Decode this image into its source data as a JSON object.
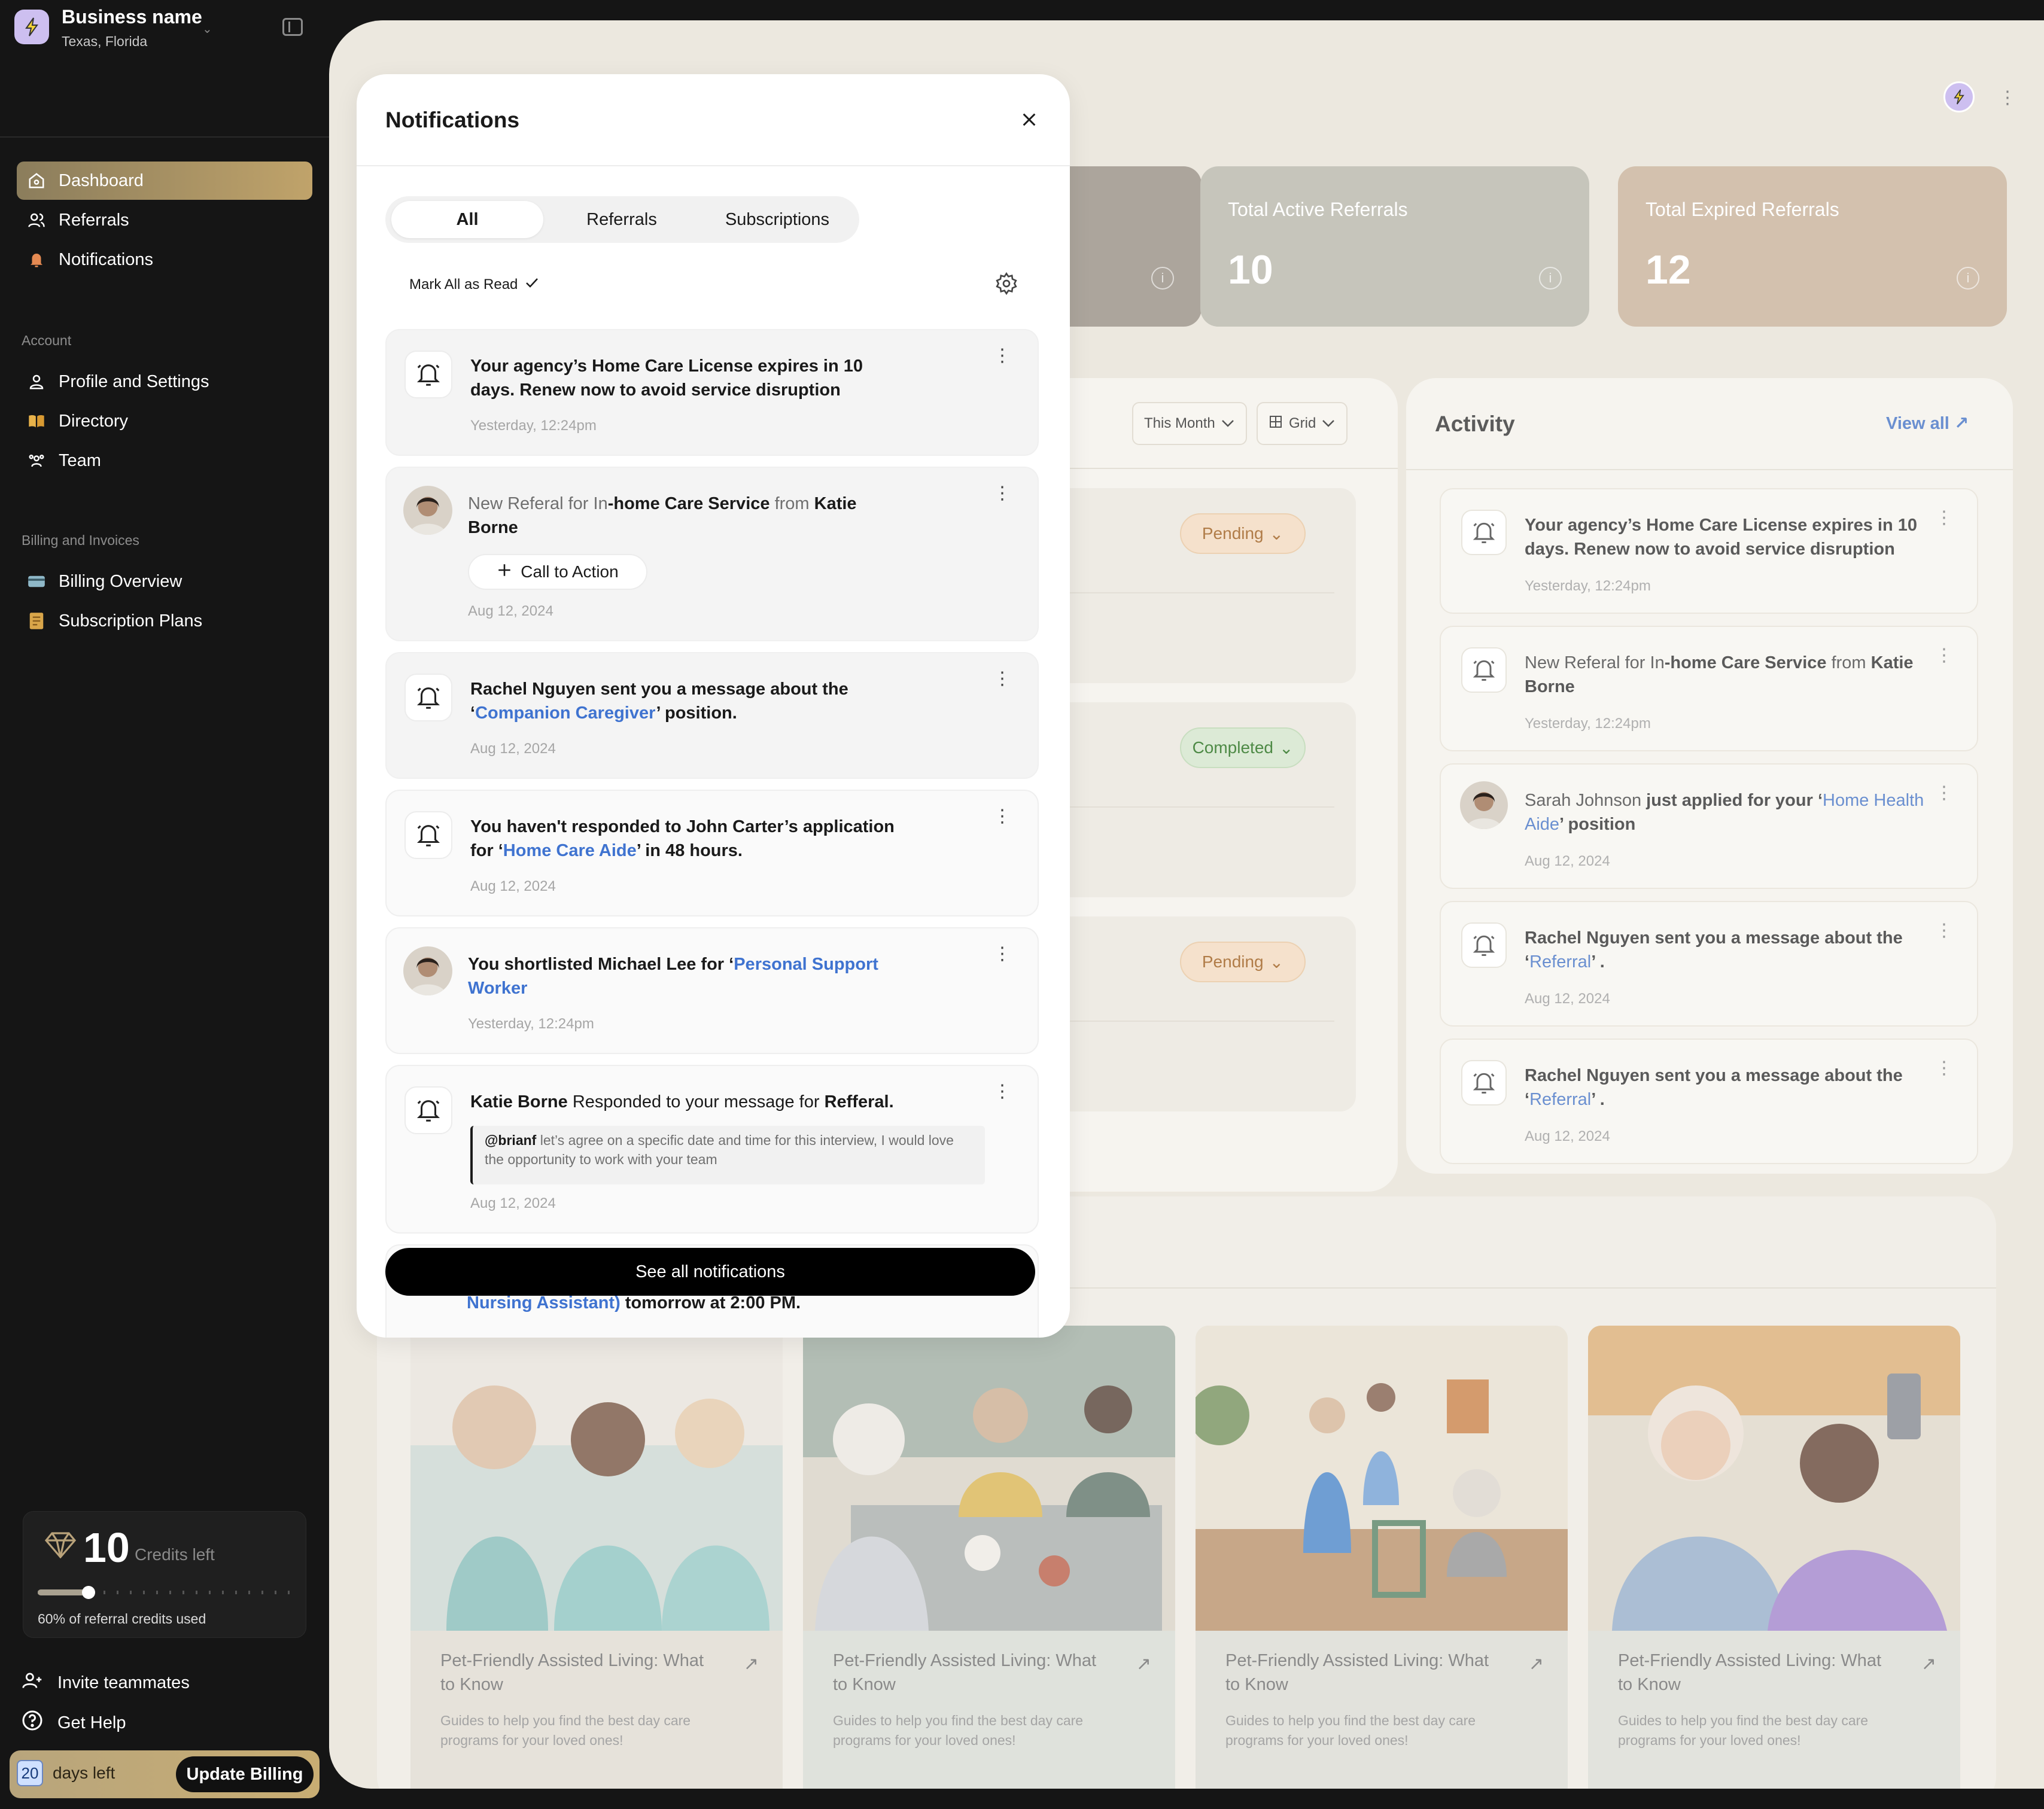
{
  "colors": {
    "accent": "#c0a36a",
    "link_blue": "#3f73d0",
    "pending": "#b07c48",
    "completed": "#4e8a46"
  },
  "business": {
    "name": "Business name",
    "location": "Texas, Florida"
  },
  "nav": {
    "main": [
      {
        "label": "Dashboard",
        "icon": "home-icon"
      },
      {
        "label": "Referrals",
        "icon": "users-icon"
      },
      {
        "label": "Notifications",
        "icon": "bell-icon"
      }
    ],
    "account_label": "Account",
    "account": [
      {
        "label": "Profile and Settings",
        "icon": "user-icon"
      },
      {
        "label": "Directory",
        "icon": "book-icon"
      },
      {
        "label": "Team",
        "icon": "team-icon"
      }
    ],
    "billing_label": "Billing and Invoices",
    "billing": [
      {
        "label": "Billing Overview",
        "icon": "card-icon"
      },
      {
        "label": "Subscription Plans",
        "icon": "receipt-icon"
      }
    ]
  },
  "credits": {
    "value": "10",
    "label": "Credits left",
    "used_text": "60% of referral credits used",
    "used_fraction": 0.2
  },
  "bottom_links": {
    "invite": "Invite teammates",
    "help": "Get Help"
  },
  "billing_bar": {
    "days": "20",
    "days_label": "days left",
    "button": "Update Billing"
  },
  "stats": [
    {
      "title": "Total Active Referrals",
      "value": "10",
      "color": "#c6c5bb"
    },
    {
      "title": "Total Expired Referrals",
      "value": "12",
      "color": "#d3c1ae"
    }
  ],
  "list": {
    "filter": "This Month",
    "view": "Grid",
    "statuses": [
      "Pending",
      "Completed",
      "Pending"
    ]
  },
  "activity": {
    "title": "Activity",
    "view_all": "View all",
    "items": [
      {
        "type": "bell",
        "text": "Your agency’s Home Care License expires in 10 days. Renew now to avoid service disruption",
        "date": "Yesterday, 12:24pm"
      },
      {
        "type": "bell",
        "pre": "New Referal for In",
        "mid": "-home Care Service",
        "from": " from ",
        "name": "Katie Borne",
        "date": "Yesterday, 12:24pm"
      },
      {
        "type": "avatar",
        "name": "Sarah Johnson",
        "action": " just applied for your ‘",
        "link": "Home Health Aide",
        "end": "’ position",
        "date": "Aug 12, 2024"
      },
      {
        "type": "bell",
        "text": "Rachel Nguyen sent you a message about the ‘",
        "link": "Referral",
        "end": "’ .",
        "date": "Aug 12, 2024"
      },
      {
        "type": "bell",
        "text": "Rachel Nguyen sent you a message about the ‘",
        "link": "Referral",
        "end": "’ .",
        "date": "Aug 12, 2024"
      }
    ]
  },
  "blogs": [
    {
      "title": "Pet-Friendly Assisted Living: What to Know",
      "desc": "Guides to help you find the best day care programs for your loved ones!"
    },
    {
      "title": "Pet-Friendly Assisted Living: What to Know",
      "desc": "Guides to help you find the best day care programs for your loved ones!"
    },
    {
      "title": "Pet-Friendly Assisted Living: What to Know",
      "desc": "Guides to help you find the best day care programs for your loved ones!"
    },
    {
      "title": "Pet-Friendly Assisted Living: What to Know",
      "desc": "Guides to help you find the best day care programs for your loved ones!"
    }
  ],
  "notifications": {
    "title": "Notifications",
    "tabs": [
      "All",
      "Referrals",
      "Subscriptions"
    ],
    "mark_all": "Mark All as Read",
    "items": [
      {
        "text": "Your agency’s Home Care License expires in 10 days. Renew now to avoid service disruption",
        "date": "Yesterday, 12:24pm"
      },
      {
        "pre": "New Referal for In",
        "mid": "-home Care Service",
        "from": " from ",
        "name": "Katie Borne",
        "cta": "Call to Action",
        "date": "Aug 12, 2024"
      },
      {
        "text": "Rachel Nguyen sent you a message about the ‘",
        "link": "Companion Caregiver",
        "end": "’ position.",
        "date": "Aug 12, 2024"
      },
      {
        "text": "You haven't responded to John Carter’s application for ‘",
        "link": "Home Care Aide",
        "end": "’ in 48 hours.",
        "date": "Aug 12, 2024"
      },
      {
        "text": "You shortlisted Michael Lee for ‘",
        "link": "Personal Support Worker",
        "date": "Yesterday, 12:24pm"
      },
      {
        "name": "Katie Borne",
        "mid": " Responded to your message for ",
        "target": "Refferal.",
        "mention": "@brianf",
        "quote": " let’s agree on a specific date and time for this interview, I would love the opportunity to work with your team",
        "date": "Aug 12, 2024"
      }
    ],
    "peek_link": "Nursing Assistant)",
    "peek_text": " tomorrow at 2:00 PM.",
    "see_all": "See all notifications"
  }
}
